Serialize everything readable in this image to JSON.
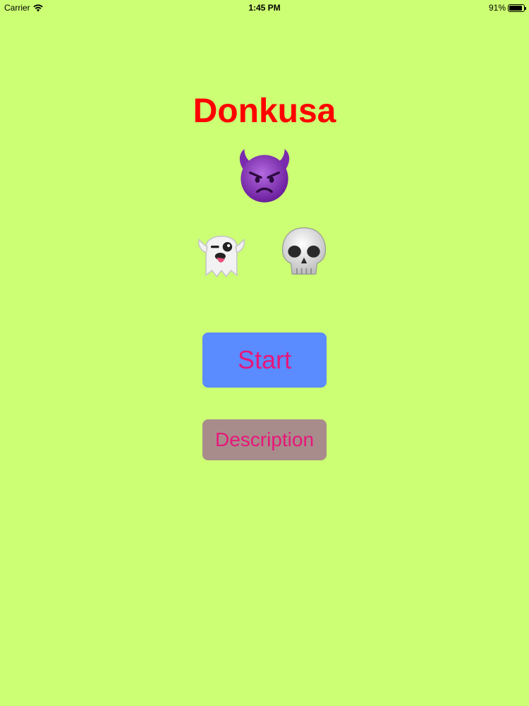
{
  "status_bar": {
    "carrier": "Carrier",
    "time": "1:45 PM",
    "battery_percent": "91%",
    "battery_level": 0.91
  },
  "app": {
    "title": "Donkusa",
    "title_color": "#ff0000",
    "background_color": "#ccff73"
  },
  "emojis": [
    {
      "name": "smiling-face-with-horns",
      "glyph": "😈"
    },
    {
      "name": "ghost",
      "glyph": "👻"
    },
    {
      "name": "skull",
      "glyph": "💀"
    }
  ],
  "buttons": {
    "start": {
      "label": "Start",
      "bg": "#5a8bff",
      "text_color": "#e6177a"
    },
    "description": {
      "label": "Description",
      "bg": "#a88c8c",
      "text_color": "#e6177a"
    }
  }
}
